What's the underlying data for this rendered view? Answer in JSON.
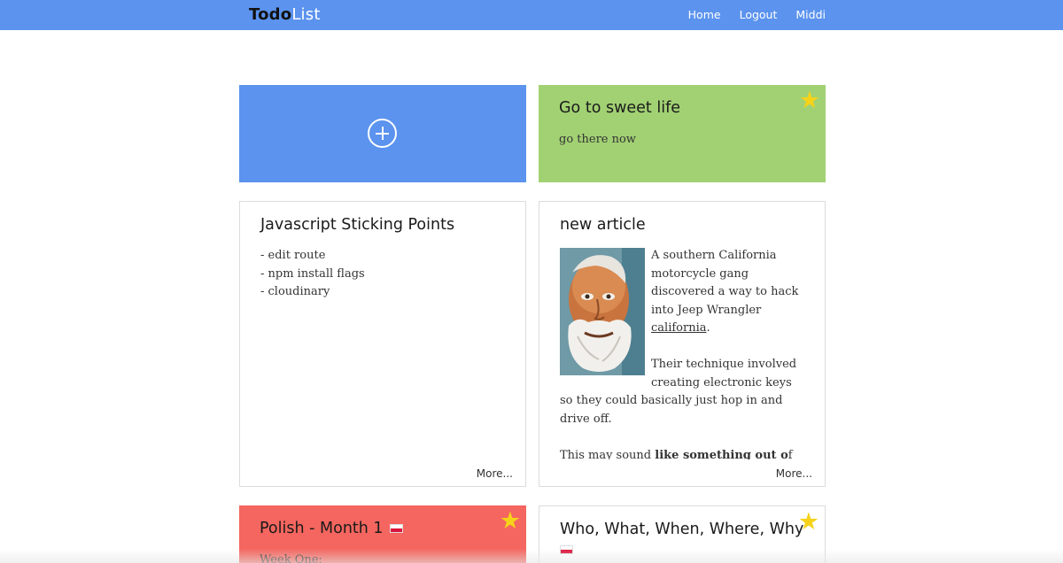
{
  "navbar": {
    "brand_bold": "Todo",
    "brand_light": "List",
    "links": [
      {
        "label": "Home"
      },
      {
        "label": "Logout"
      },
      {
        "label": "Middi"
      }
    ]
  },
  "colors": {
    "nav": "#5b93ee",
    "add_card": "#5b93ee",
    "green_card": "#a2d173",
    "red_card": "#f4665f",
    "star": "#f6d21a"
  },
  "cards": {
    "add": {
      "icon": "plus-circle-icon"
    },
    "sweet_life": {
      "title": "Go to sweet life",
      "body": "go there now",
      "starred": true
    },
    "js": {
      "title": "Javascript Sticking Points",
      "items": [
        "- edit route",
        "- npm install flags",
        "- cloudinary"
      ],
      "more": "More..."
    },
    "article": {
      "title": "new article",
      "p1_before": "A southern California motorcycle gang discovered a way to hack into Jeep Wrangler ",
      "p1_link": "california",
      "p1_after": ".",
      "p2": "Their technique involved creating electronic keys so they could basically just hop in and drive off.",
      "p3_before": "This may sound ",
      "p3_bold": "like something out o",
      "p3_after": "f Breaking Bad, but it really happened.",
      "more": "More..."
    },
    "polish": {
      "title": "Polish - Month 1",
      "body": "Week One:",
      "starred": true
    },
    "who": {
      "title": "Who, What, When, Where, Why",
      "starred": true
    }
  }
}
